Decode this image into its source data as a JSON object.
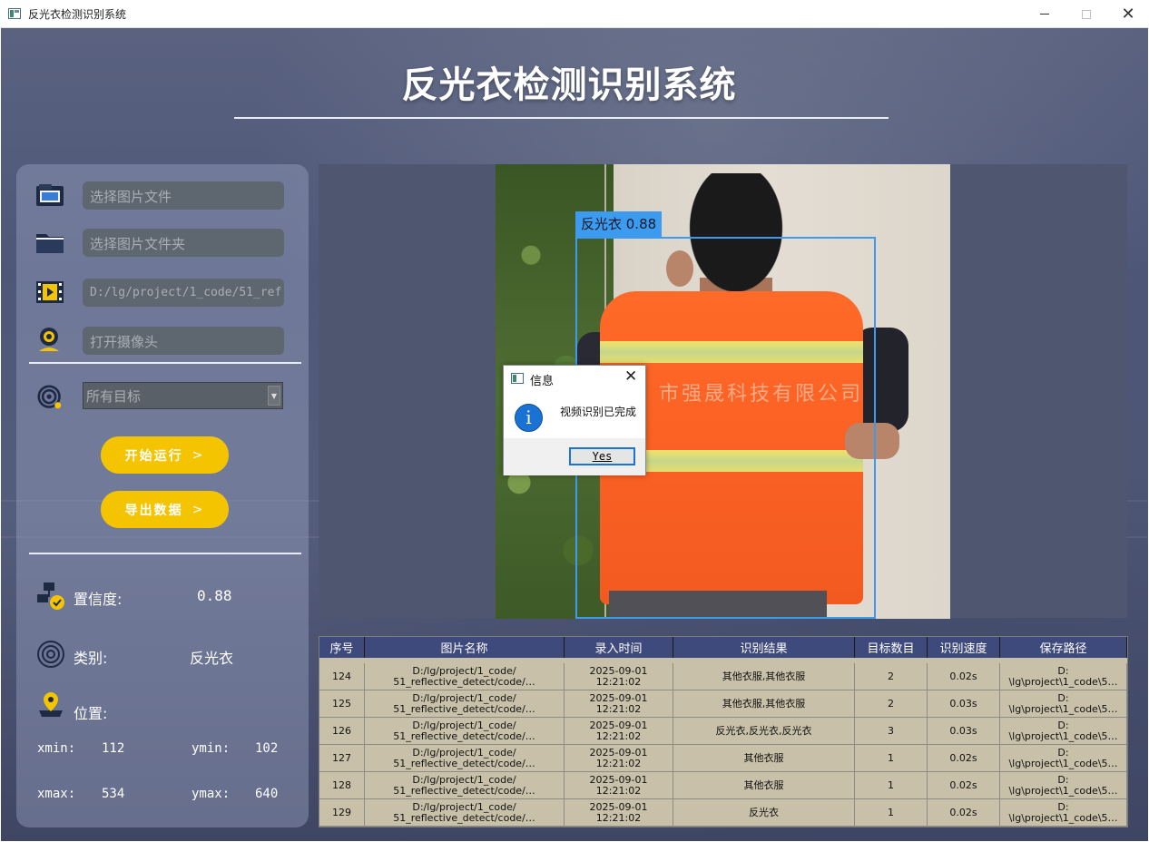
{
  "window": {
    "title": "反光衣检测识别系统",
    "minimize": "—",
    "close": "✕"
  },
  "header": {
    "title": "反光衣检测识别系统"
  },
  "controls": {
    "image_file_placeholder": "选择图片文件",
    "image_folder_placeholder": "选择图片文件夹",
    "video_path_value": "D:/lg/project/1_code/51_ref",
    "camera_placeholder": "打开摄像头",
    "target_select_value": "所有目标",
    "start_button": "开始运行",
    "export_button": "导出数据",
    "button_chevron": ">"
  },
  "result": {
    "confidence_label": "置信度:",
    "confidence_value": "0.88",
    "class_label": "类别:",
    "class_value": "反光衣",
    "position_label": "位置:",
    "xmin_label": "xmin:",
    "xmin_value": "112",
    "ymin_label": "ymin:",
    "ymin_value": "102",
    "xmax_label": "xmax:",
    "xmax_value": "534",
    "ymax_label": "ymax:",
    "ymax_value": "640"
  },
  "detection": {
    "box_label": "反光衣 0.88",
    "box_color": "#3d9bef",
    "watermark": "市强晟科技有限公司"
  },
  "dialog": {
    "title": "信息",
    "close": "✕",
    "icon": "i",
    "message": "视频识别已完成",
    "yes_button": "Yes"
  },
  "table": {
    "columns": [
      "序号",
      "图片名称",
      "录入时间",
      "识别结果",
      "目标数目",
      "识别速度",
      "保存路径"
    ],
    "rows": [
      {
        "id": "124",
        "name1": "D:/lg/project/1_code/",
        "name2": "51_reflective_detect/code/…",
        "date": "2025-09-01",
        "time": "12:21:02",
        "result": "其他衣服,其他衣服",
        "count": "2",
        "speed": "0.02s",
        "path1": "D:",
        "path2": "\\lg\\project\\1_code\\5…"
      },
      {
        "id": "125",
        "name1": "D:/lg/project/1_code/",
        "name2": "51_reflective_detect/code/…",
        "date": "2025-09-01",
        "time": "12:21:02",
        "result": "其他衣服,其他衣服",
        "count": "2",
        "speed": "0.03s",
        "path1": "D:",
        "path2": "\\lg\\project\\1_code\\5…"
      },
      {
        "id": "126",
        "name1": "D:/lg/project/1_code/",
        "name2": "51_reflective_detect/code/…",
        "date": "2025-09-01",
        "time": "12:21:02",
        "result": "反光衣,反光衣,反光衣",
        "count": "3",
        "speed": "0.03s",
        "path1": "D:",
        "path2": "\\lg\\project\\1_code\\5…"
      },
      {
        "id": "127",
        "name1": "D:/lg/project/1_code/",
        "name2": "51_reflective_detect/code/…",
        "date": "2025-09-01",
        "time": "12:21:02",
        "result": "其他衣服",
        "count": "1",
        "speed": "0.02s",
        "path1": "D:",
        "path2": "\\lg\\project\\1_code\\5…"
      },
      {
        "id": "128",
        "name1": "D:/lg/project/1_code/",
        "name2": "51_reflective_detect/code/…",
        "date": "2025-09-01",
        "time": "12:21:02",
        "result": "其他衣服",
        "count": "1",
        "speed": "0.02s",
        "path1": "D:",
        "path2": "\\lg\\project\\1_code\\5…"
      },
      {
        "id": "129",
        "name1": "D:/lg/project/1_code/",
        "name2": "51_reflective_detect/code/…",
        "date": "2025-09-01",
        "time": "12:21:02",
        "result": "反光衣",
        "count": "1",
        "speed": "0.02s",
        "path1": "D:",
        "path2": "\\lg\\project\\1_code\\5…"
      }
    ]
  },
  "icons": {
    "image_file": "image-folder-icon",
    "image_folder": "folder-icon",
    "video": "video-icon",
    "camera": "camera-icon",
    "target": "target-icon",
    "confidence": "confidence-icon",
    "class": "class-icon",
    "position": "location-icon"
  },
  "colors": {
    "accent_yellow": "#f5c400",
    "table_header": "#3f4a7c",
    "table_body": "#c8c0a8"
  }
}
